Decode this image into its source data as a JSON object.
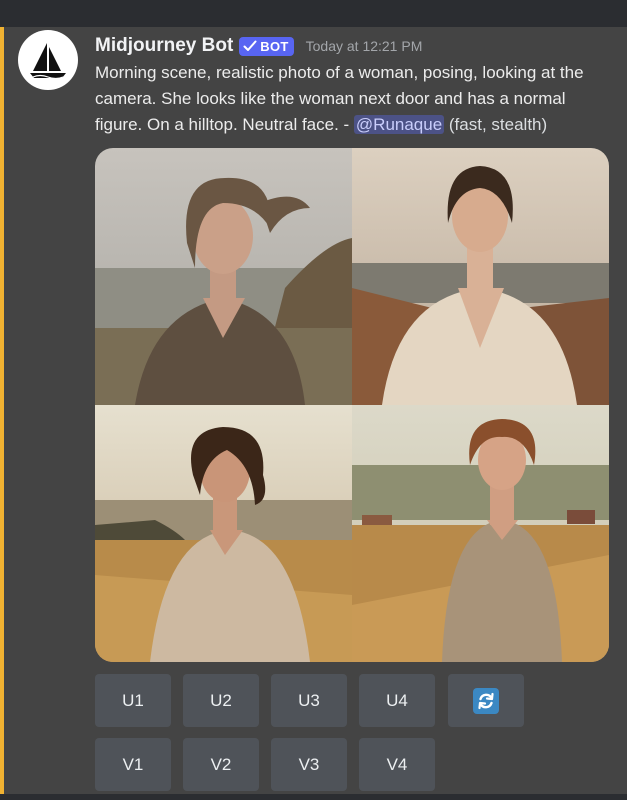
{
  "message": {
    "author": "Midjourney Bot",
    "badge": "BOT",
    "timestamp": "Today at 12:21 PM",
    "prompt": "Morning scene, realistic photo of a woman, posing, looking at the camera. She looks like the woman next door and has a normal figure. On a hilltop. Neutral face.",
    "separator": " - ",
    "mention": "@Runaque",
    "meta": " (fast, stealth)"
  },
  "grid_images": [
    {
      "alt": "Woman with windswept hair on a hilltop in hazy morning light"
    },
    {
      "alt": "Woman in a cream blouse on a hillside at dawn"
    },
    {
      "alt": "Woman in a beige sweater standing in tall golden grass"
    },
    {
      "alt": "Woman in a knit sweater in a golden field with farmland behind"
    }
  ],
  "buttons": {
    "upscale": [
      "U1",
      "U2",
      "U3",
      "U4"
    ],
    "variation": [
      "V1",
      "V2",
      "V3",
      "V4"
    ],
    "reroll_icon": "refresh-icon"
  },
  "colors": {
    "accent": "#5865f2",
    "mention_bar": "#f0b232",
    "button_bg": "#4f5359",
    "reroll_icon_bg": "#3b88c3"
  }
}
